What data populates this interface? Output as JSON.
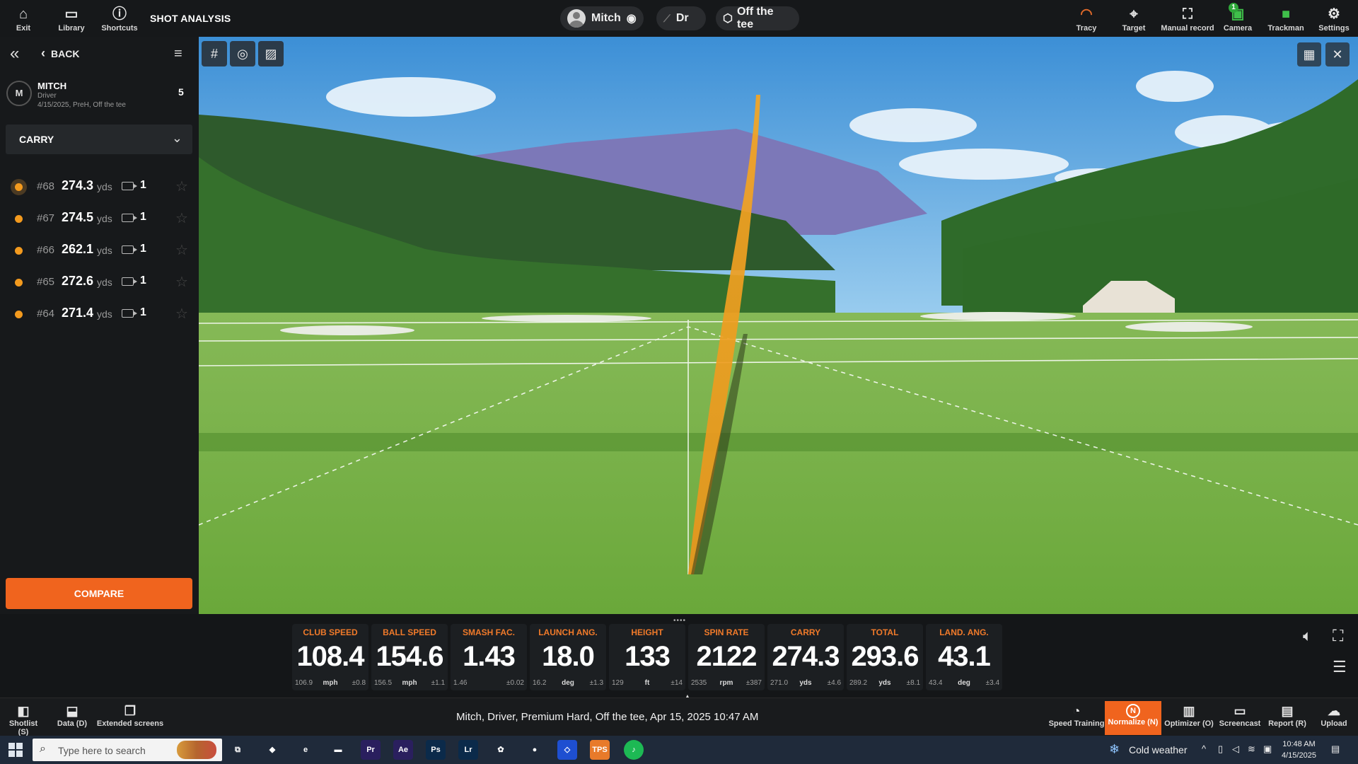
{
  "app": {
    "title": "SHOT ANALYSIS",
    "top_left_buttons": [
      {
        "label": "Exit",
        "icon": "home-icon"
      },
      {
        "label": "Library",
        "icon": "folder-icon"
      },
      {
        "label": "Shortcuts",
        "icon": "help-icon"
      }
    ],
    "player_pill": {
      "name": "Mitch"
    },
    "club_pill": {
      "label": "Dr"
    },
    "tee_pill": {
      "label": "Off the tee"
    },
    "top_right_buttons": [
      {
        "label": "Tracy",
        "icon": "tracy-icon"
      },
      {
        "label": "Target",
        "icon": "target-icon"
      },
      {
        "label": "Manual record",
        "icon": "manual-record-icon"
      },
      {
        "label": "Camera",
        "icon": "camera-icon",
        "badge": "1"
      },
      {
        "label": "Trackman",
        "icon": "trackman-icon"
      },
      {
        "label": "Settings",
        "icon": "gear-icon"
      }
    ]
  },
  "sidebar": {
    "back_label": "BACK",
    "player": {
      "initial": "M",
      "name": "MITCH",
      "club": "Driver",
      "meta": "4/15/2025, PreH, Off the tee",
      "count": "5"
    },
    "sort_label": "CARRY",
    "shots": [
      {
        "num": "#68",
        "value": "274.3",
        "unit": "yds",
        "videos": "1",
        "selected": true
      },
      {
        "num": "#67",
        "value": "274.5",
        "unit": "yds",
        "videos": "1",
        "selected": false
      },
      {
        "num": "#66",
        "value": "262.1",
        "unit": "yds",
        "videos": "1",
        "selected": false
      },
      {
        "num": "#65",
        "value": "272.6",
        "unit": "yds",
        "videos": "1",
        "selected": false
      },
      {
        "num": "#64",
        "value": "271.4",
        "unit": "yds",
        "videos": "1",
        "selected": false
      }
    ],
    "compare_label": "COMPARE"
  },
  "stats": [
    {
      "label": "CLUB SPEED",
      "value": "108.4",
      "avg": "106.9",
      "unit": "mph",
      "dev": "±0.8"
    },
    {
      "label": "BALL SPEED",
      "value": "154.6",
      "avg": "156.5",
      "unit": "mph",
      "dev": "±1.1"
    },
    {
      "label": "SMASH FAC.",
      "value": "1.43",
      "avg": "1.46",
      "unit": "",
      "dev": "±0.02"
    },
    {
      "label": "LAUNCH ANG.",
      "value": "18.0",
      "avg": "16.2",
      "unit": "deg",
      "dev": "±1.3"
    },
    {
      "label": "HEIGHT",
      "value": "133",
      "avg": "129",
      "unit": "ft",
      "dev": "±14"
    },
    {
      "label": "SPIN RATE",
      "value": "2122",
      "avg": "2535",
      "unit": "rpm",
      "dev": "±387"
    },
    {
      "label": "CARRY",
      "value": "274.3",
      "avg": "271.0",
      "unit": "yds",
      "dev": "±4.6"
    },
    {
      "label": "TOTAL",
      "value": "293.6",
      "avg": "289.2",
      "unit": "yds",
      "dev": "±8.1"
    },
    {
      "label": "LAND. ANG.",
      "value": "43.1",
      "avg": "43.4",
      "unit": "deg",
      "dev": "±3.4"
    }
  ],
  "bottom": {
    "left_buttons": [
      {
        "label": "Shotlist (S)",
        "icon": "shotlist-icon"
      },
      {
        "label": "Data (D)",
        "icon": "data-icon"
      },
      {
        "label": "Extended screens",
        "icon": "extended-screens-icon"
      }
    ],
    "description": "Mitch, Driver, Premium Hard, Off the tee, Apr 15, 2025 10:47 AM",
    "right_buttons": [
      {
        "label": "Speed Training",
        "icon": "speed-training-icon"
      },
      {
        "label": "Normalize (N)",
        "icon": "normalize-icon",
        "active": true
      },
      {
        "label": "Optimizer (O)",
        "icon": "optimizer-icon"
      },
      {
        "label": "Screencast",
        "icon": "screencast-icon"
      },
      {
        "label": "Report (R)",
        "icon": "report-icon"
      },
      {
        "label": "Upload",
        "icon": "upload-icon"
      }
    ],
    "normalize_glyph": "N"
  },
  "taskbar": {
    "search_placeholder": "Type here to search",
    "weather": "Cold weather",
    "time": "10:48 AM",
    "date": "4/15/2025",
    "apps": [
      {
        "name": "task-view",
        "glyph": "⧉"
      },
      {
        "name": "copilot",
        "glyph": "◆"
      },
      {
        "name": "edge",
        "glyph": "e"
      },
      {
        "name": "file-explorer",
        "glyph": "▬"
      },
      {
        "name": "premiere",
        "glyph": "Pr"
      },
      {
        "name": "after-effects",
        "glyph": "Ae"
      },
      {
        "name": "photoshop",
        "glyph": "Ps"
      },
      {
        "name": "lightroom",
        "glyph": "Lr"
      },
      {
        "name": "paint",
        "glyph": "✿"
      },
      {
        "name": "obs",
        "glyph": "●"
      },
      {
        "name": "dropbox",
        "glyph": "◇"
      },
      {
        "name": "tps",
        "glyph": "TPS"
      },
      {
        "name": "spotify",
        "glyph": "♪"
      }
    ]
  },
  "colors": {
    "accent": "#f0641e",
    "shot_dot": "#f39a1e",
    "stat_label": "#f07a2a",
    "trajectory": "#f5a623"
  }
}
